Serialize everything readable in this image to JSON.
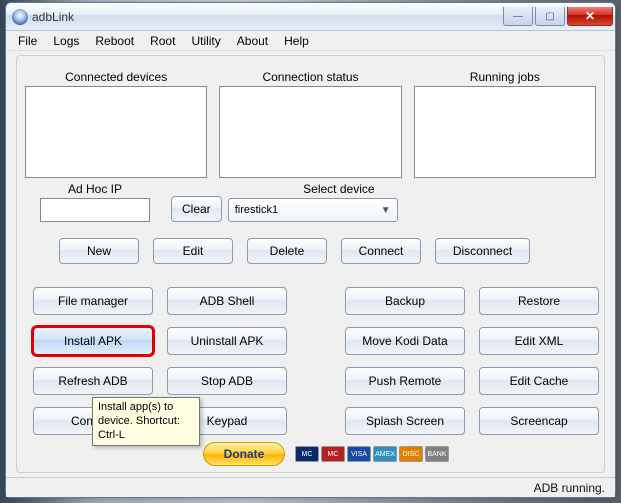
{
  "window": {
    "title": "adbLink"
  },
  "menu": {
    "file": "File",
    "logs": "Logs",
    "reboot": "Reboot",
    "root": "Root",
    "utility": "Utility",
    "about": "About",
    "help": "Help"
  },
  "sections": {
    "connected": "Connected devices",
    "status": "Connection status",
    "jobs": "Running jobs"
  },
  "adhoc": {
    "label": "Ad Hoc IP",
    "value": "",
    "clear": "Clear"
  },
  "select": {
    "label": "Select device",
    "value": "firestick1"
  },
  "actions": {
    "new": "New",
    "edit": "Edit",
    "delete": "Delete",
    "connect": "Connect",
    "disconnect": "Disconnect"
  },
  "buttons": {
    "file_manager": "File manager",
    "adb_shell": "ADB Shell",
    "backup": "Backup",
    "restore": "Restore",
    "install_apk": "Install APK",
    "uninstall_apk": "Uninstall APK",
    "move_kodi": "Move Kodi Data",
    "edit_xml": "Edit XML",
    "refresh": "Refresh ADB",
    "stop_adb": "Stop ADB",
    "push_remote": "Push Remote",
    "edit_cache": "Edit Cache",
    "console": "Console",
    "keypad": "Keypad",
    "splash": "Splash Screen",
    "screencap": "Screencap"
  },
  "tooltip": "Install app(s) to device. Shortcut: Ctrl-L",
  "donate": "Donate",
  "cards": [
    "MC",
    "MC",
    "VISA",
    "AMEX",
    "DISC",
    "BANK"
  ],
  "card_colors": [
    "#0a2a6c",
    "#b22222",
    "#1a4aa0",
    "#2f8fbf",
    "#e08000",
    "#808080"
  ],
  "status": "ADB running."
}
